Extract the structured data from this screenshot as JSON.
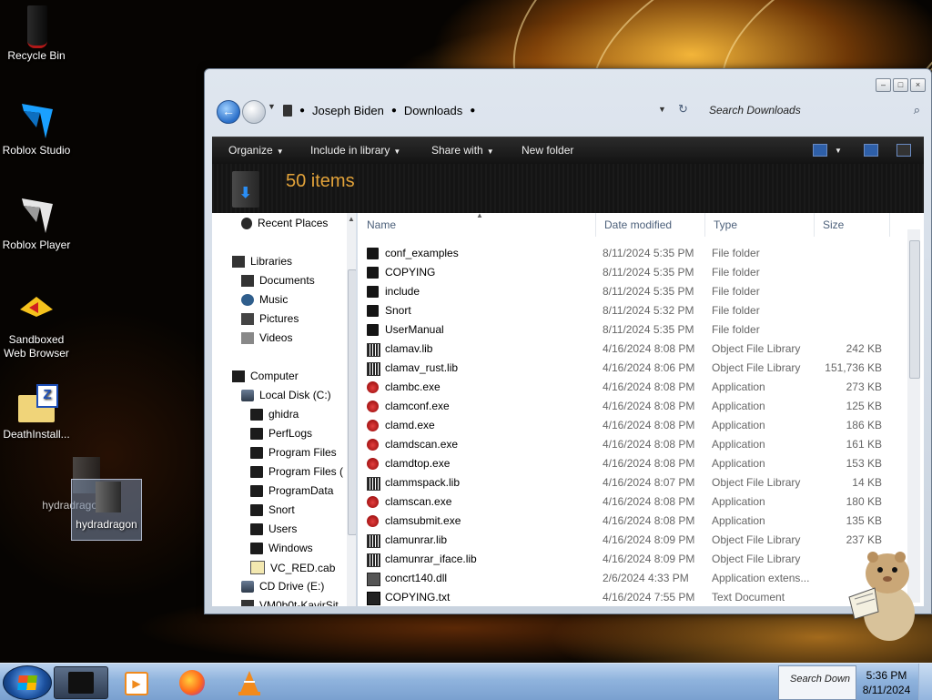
{
  "desktop": {
    "icons": [
      {
        "label": "Recycle Bin"
      },
      {
        "label": "Roblox Studio"
      },
      {
        "label": "Roblox Player"
      },
      {
        "label": "Sandboxed Web Browser"
      },
      {
        "label": "DeathInstall..."
      },
      {
        "label": "hydradragon"
      },
      {
        "label": "hydradragon"
      }
    ]
  },
  "window": {
    "breadcrumb": [
      "Joseph Biden",
      "Downloads"
    ],
    "search_placeholder": "Search Downloads",
    "toolbar": {
      "organize": "Organize",
      "include_in_library": "Include in library",
      "share_with": "Share with",
      "new_folder": "New folder"
    },
    "details": {
      "item_count": "50 items"
    },
    "navigation": {
      "recent_places": "Recent Places",
      "libraries": "Libraries",
      "documents": "Documents",
      "music": "Music",
      "pictures": "Pictures",
      "videos": "Videos",
      "computer": "Computer",
      "local_disk": "Local Disk (C:)",
      "folders": [
        "ghidra",
        "PerfLogs",
        "Program Files",
        "Program Files (",
        "ProgramData",
        "Snort",
        "Users",
        "Windows",
        "VC_RED.cab"
      ],
      "cd_drive": "CD Drive (E:)",
      "cut_item": "VM0b0t-KavirSit"
    },
    "columns": {
      "name": "Name",
      "date": "Date modified",
      "type": "Type",
      "size": "Size"
    },
    "files": [
      {
        "name": "conf_examples",
        "date": "8/11/2024 5:35 PM",
        "type": "File folder",
        "size": "",
        "icon": "folder-icon"
      },
      {
        "name": "COPYING",
        "date": "8/11/2024 5:35 PM",
        "type": "File folder",
        "size": "",
        "icon": "folder-icon"
      },
      {
        "name": "include",
        "date": "8/11/2024 5:35 PM",
        "type": "File folder",
        "size": "",
        "icon": "folder-icon"
      },
      {
        "name": "Snort",
        "date": "8/11/2024 5:32 PM",
        "type": "File folder",
        "size": "",
        "icon": "folder-icon"
      },
      {
        "name": "UserManual",
        "date": "8/11/2024 5:35 PM",
        "type": "File folder",
        "size": "",
        "icon": "folder-icon"
      },
      {
        "name": "clamav.lib",
        "date": "4/16/2024 8:08 PM",
        "type": "Object File Library",
        "size": "242 KB",
        "icon": "library-file-icon"
      },
      {
        "name": "clamav_rust.lib",
        "date": "4/16/2024 8:06 PM",
        "type": "Object File Library",
        "size": "151,736 KB",
        "icon": "library-file-icon"
      },
      {
        "name": "clambc.exe",
        "date": "4/16/2024 8:08 PM",
        "type": "Application",
        "size": "273 KB",
        "icon": "clamav-app-icon"
      },
      {
        "name": "clamconf.exe",
        "date": "4/16/2024 8:08 PM",
        "type": "Application",
        "size": "125 KB",
        "icon": "clamav-app-icon"
      },
      {
        "name": "clamd.exe",
        "date": "4/16/2024 8:08 PM",
        "type": "Application",
        "size": "186 KB",
        "icon": "clamav-app-icon"
      },
      {
        "name": "clamdscan.exe",
        "date": "4/16/2024 8:08 PM",
        "type": "Application",
        "size": "161 KB",
        "icon": "clamav-app-icon"
      },
      {
        "name": "clamdtop.exe",
        "date": "4/16/2024 8:08 PM",
        "type": "Application",
        "size": "153 KB",
        "icon": "clamav-app-icon"
      },
      {
        "name": "clammspack.lib",
        "date": "4/16/2024 8:07 PM",
        "type": "Object File Library",
        "size": "14 KB",
        "icon": "library-file-icon"
      },
      {
        "name": "clamscan.exe",
        "date": "4/16/2024 8:08 PM",
        "type": "Application",
        "size": "180 KB",
        "icon": "clamav-app-icon"
      },
      {
        "name": "clamsubmit.exe",
        "date": "4/16/2024 8:08 PM",
        "type": "Application",
        "size": "135 KB",
        "icon": "clamav-app-icon"
      },
      {
        "name": "clamunrar.lib",
        "date": "4/16/2024 8:09 PM",
        "type": "Object File Library",
        "size": "237 KB",
        "icon": "library-file-icon"
      },
      {
        "name": "clamunrar_iface.lib",
        "date": "4/16/2024 8:09 PM",
        "type": "Object File Library",
        "size": "",
        "icon": "library-file-icon"
      },
      {
        "name": "concrt140.dll",
        "date": "2/6/2024 4:33 PM",
        "type": "Application extens...",
        "size": "",
        "icon": "dll-icon"
      },
      {
        "name": "COPYING.txt",
        "date": "4/16/2024 7:55 PM",
        "type": "Text Document",
        "size": "",
        "icon": "text-file-icon"
      }
    ]
  },
  "taskbar": {
    "tray_thumbnail_text": "Search Down",
    "time": "5:36 PM",
    "date": "8/11/2024"
  }
}
